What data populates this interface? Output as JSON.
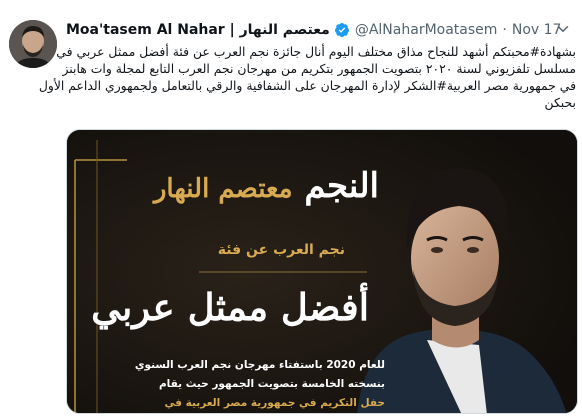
{
  "tweet": {
    "author": {
      "display_name": "Moa'tasem Al Nahar | معتصم النهار",
      "verified_icon": "verified-badge-icon",
      "handle": "@AlNaharMoatasem",
      "separator": "·",
      "timestamp": "Nov 17"
    },
    "text_lines": [
      "بشهادة#محبتكم أشهد للنجاح مذاق مختلف اليوم أنال جائزة نجم العرب عن فئة أفضل ممثل عربي في",
      "مسلسل تلفزيوني لسنة ٢٠٢٠ بتصويت الجمهور بتكريم من مهرجان نجم العرب التابع لمجلة وات هابنز",
      "في جمهورية مصر العربية#الشكر لإدارة المهرجان على الشفافية والرقي بالتعامل ولجمهوري الداعم الأول",
      "بحبكن"
    ],
    "media": {
      "title_line1": "النجم",
      "title_line1_name": "معتصم النهار",
      "subtitle": "نجم العرب عن فئة",
      "title_line2": "أفضل ممثل عربي",
      "lines": [
        "للعام 2020 باستفتاء مهرجان نجم العرب السنوي",
        "بنسخته الخامسة بتصويت الجمهور حيث يقام",
        "حفل التكريم في جمهورية مصر العربية في"
      ],
      "colors": {
        "background": "#17130f",
        "gold": "#d8aa52",
        "white": "#ffffff"
      }
    },
    "more_icon": "chevron-down-icon",
    "accent_color": "#1d9bf0"
  }
}
